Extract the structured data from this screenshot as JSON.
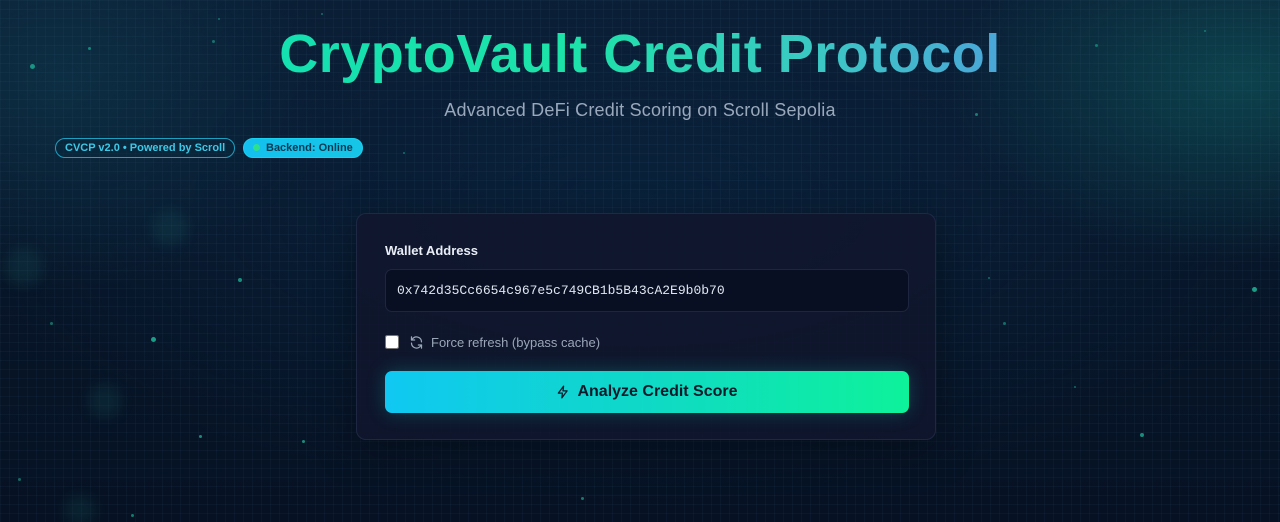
{
  "header": {
    "title": "CryptoVault Credit Protocol",
    "subtitle": "Advanced DeFi Credit Scoring on Scroll Sepolia"
  },
  "badges": {
    "version": "CVCP v2.0 • Powered by Scroll",
    "backend": "Backend: Online",
    "backend_status_color": "#2de08a"
  },
  "form": {
    "wallet_label": "Wallet Address",
    "wallet_value": "0x742d35Cc6654c967e5c749CB1b5B43cA2E9b0b70",
    "force_refresh_label": "Force refresh (bypass cache)",
    "force_refresh_checked": false,
    "analyze_button_label": "Analyze Credit Score",
    "refresh_icon": "refresh-icon",
    "analyze_icon": "lightning-bolt-icon"
  },
  "colors": {
    "accent_start": "#10c8f2",
    "accent_end": "#0ef29a",
    "title_gradient_start": "#14e0b0",
    "title_gradient_end": "#4aa6d8",
    "background": "#071528"
  }
}
